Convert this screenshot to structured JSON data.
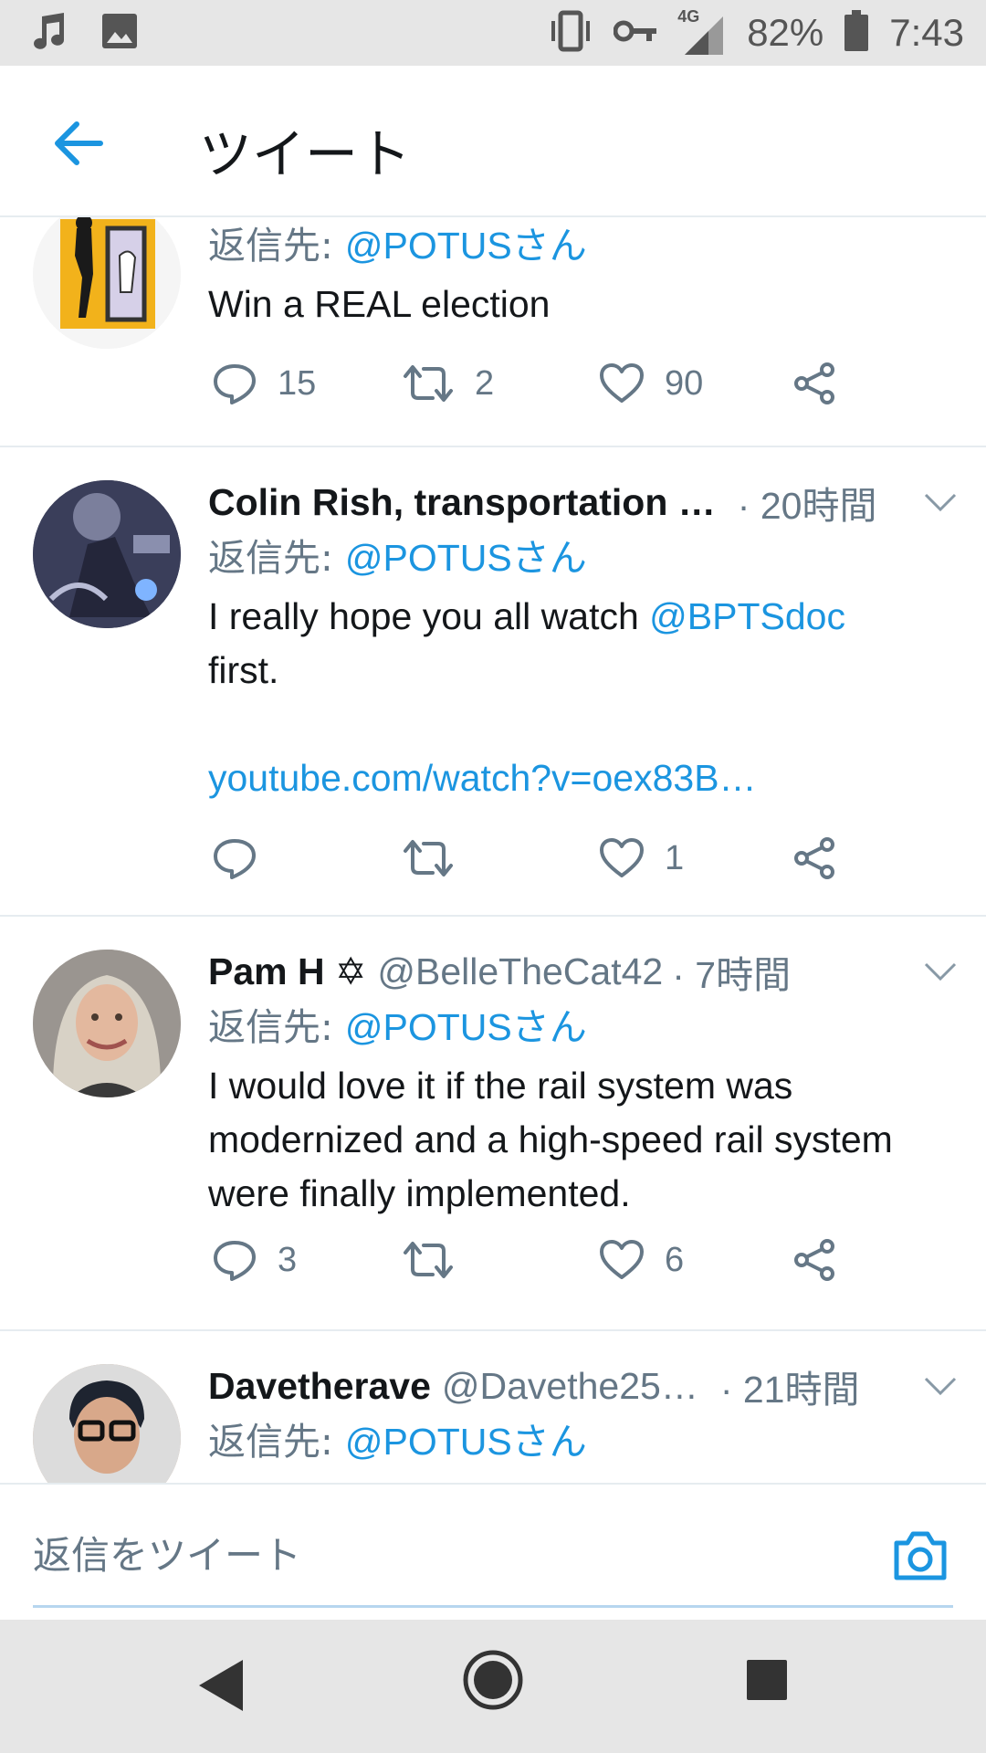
{
  "status_bar": {
    "battery": "82%",
    "time": "7:43",
    "network": "4G",
    "icons": [
      "music-note-icon",
      "image-icon",
      "vibrate-icon",
      "vpn-key-icon",
      "signal-icon",
      "battery-icon"
    ]
  },
  "header": {
    "title": "ツイート",
    "back_icon": "back-arrow-icon"
  },
  "reply_prefix": "返信先: ",
  "tweets": [
    {
      "reply_to": "@POTUSさん",
      "text": "Win a REAL election",
      "replies": "15",
      "retweets": "2",
      "likes": "90"
    },
    {
      "name": "Colin Rish, transportation …",
      "time": "· 20時間",
      "reply_to": "@POTUSさん",
      "text_before": "I really hope you all watch ",
      "mention": "@BPTSdoc",
      "text_after": "first.",
      "link": "youtube.com/watch?v=oex83B…",
      "replies": "",
      "retweets": "",
      "likes": "1"
    },
    {
      "name": "Pam H ✡",
      "handle": "@BelleTheCat42",
      "time": "· 7時間",
      "reply_to": "@POTUSさん",
      "text": "I would love it if the rail system was modernized and a high-speed rail system were finally implemented.",
      "replies": "3",
      "retweets": "",
      "likes": "6"
    },
    {
      "name": "Davetherave",
      "handle": "@Davethe25…",
      "time": "· 21時間",
      "reply_to": "@POTUSさん"
    }
  ],
  "composer": {
    "placeholder": "返信をツイート",
    "camera_icon": "camera-icon"
  },
  "colors": {
    "accent": "#1b95e0",
    "secondary_text": "#657786",
    "divider": "#e6ecf0"
  }
}
